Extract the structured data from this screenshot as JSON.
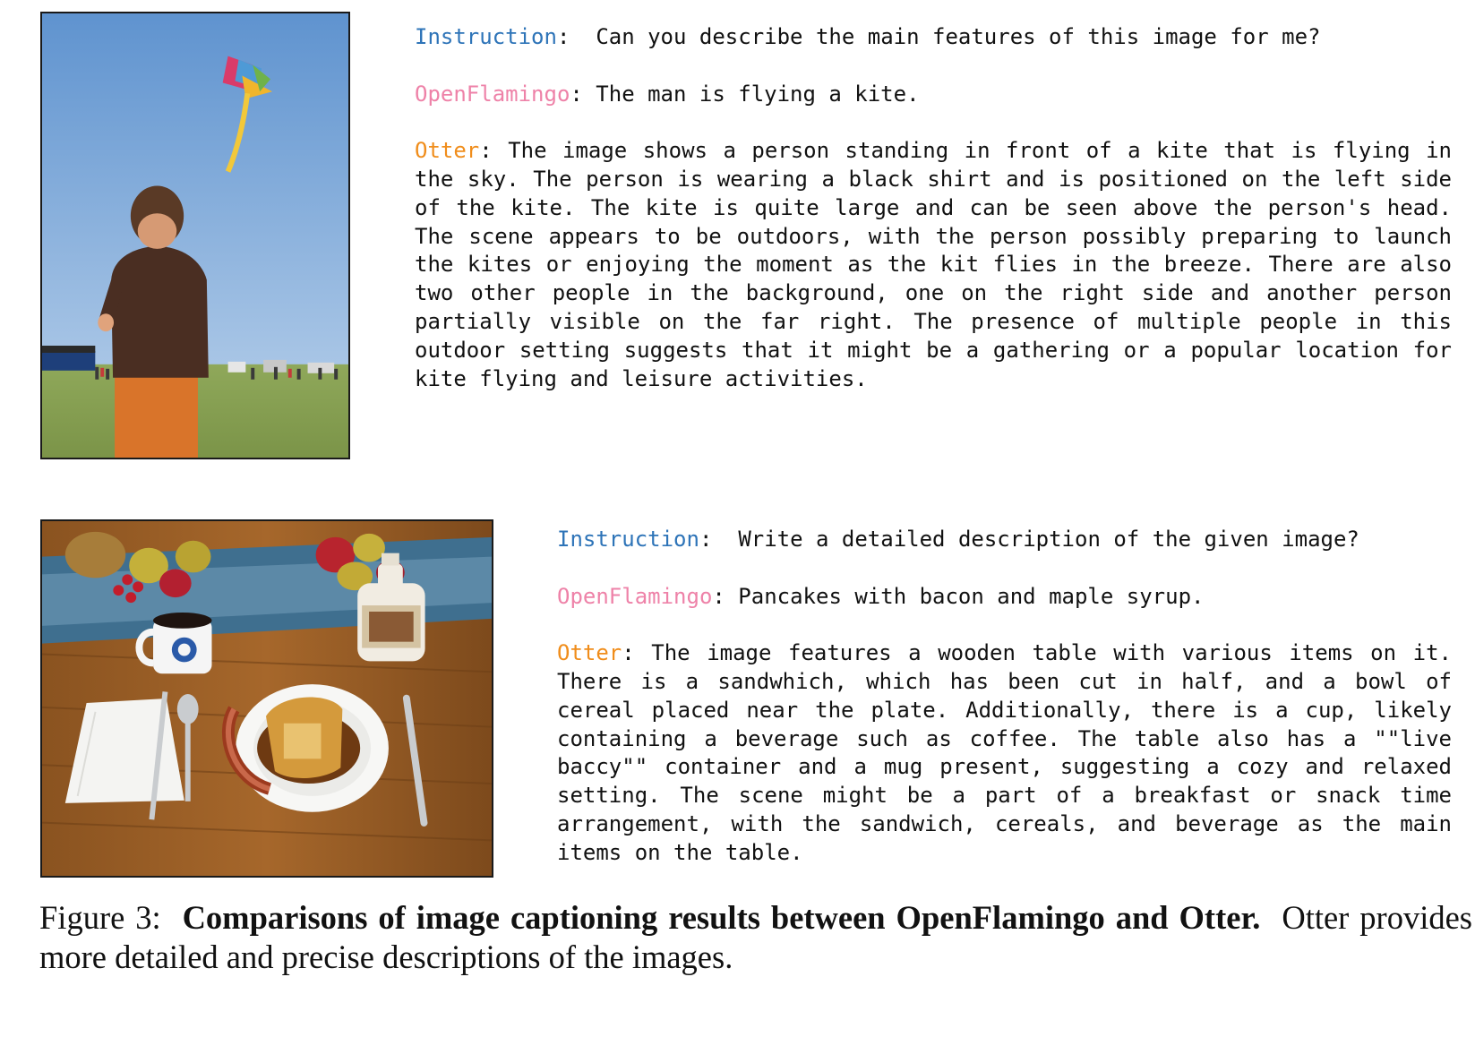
{
  "examples": [
    {
      "photo_alt": "",
      "instruction_label": "Instruction",
      "instruction_sep": ":  ",
      "instruction_text": "Can you describe the main features of this image for me?",
      "openflamingo_label": "OpenFlamingo",
      "openflamingo_sep": ": ",
      "openflamingo_text": "The man is flying a kite.",
      "otter_label": "Otter",
      "otter_sep": ": ",
      "otter_text": "The image shows a person standing in front of a kite that is flying in the sky. The person is wearing a black shirt and is positioned on the left side of the kite. The kite is quite large and can be seen above the person's head. The scene appears to be outdoors, with the person possibly preparing to launch the kites or enjoying the moment as the kit flies in the breeze. There are also two other people in the background, one on the right side and another person partially visible on the far right. The presence of multiple people in this outdoor setting suggests that it might be a gathering or a popular location for kite flying and leisure activities."
    },
    {
      "photo_alt": "",
      "instruction_label": "Instruction",
      "instruction_sep": ":  ",
      "instruction_text": "Write a detailed description of the given image?",
      "openflamingo_label": "OpenFlamingo",
      "openflamingo_sep": ": ",
      "openflamingo_text": "Pancakes with bacon and maple syrup.",
      "otter_label": "Otter",
      "otter_sep": ": ",
      "otter_text": "The image features a wooden table with various items on it. There is a sandwhich, which has been cut in half, and a bowl of cereal placed near the plate. Additionally, there is a cup, likely containing a beverage such as coffee. The table also has a \"\"live baccy\"\" container and a mug present, suggesting a cozy and relaxed setting. The scene might be a part of a breakfast or snack time arrangement, with the sandwich, cereals, and beverage as the main items on the table."
    }
  ],
  "caption": {
    "prefix": "Figure 3:  ",
    "bold": "Comparisons of image captioning results between OpenFlamingo and Otter.",
    "rest": "  Otter provides more detailed and precise descriptions of the images."
  },
  "colors": {
    "instruction": "#2e74b8",
    "openflamingo": "#ee82a8",
    "otter": "#f08d1b"
  }
}
